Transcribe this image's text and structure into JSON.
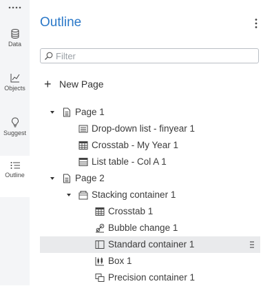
{
  "rail": {
    "items": [
      {
        "label": "Data",
        "icon": "database-icon"
      },
      {
        "label": "Objects",
        "icon": "line-chart-icon"
      },
      {
        "label": "Suggest",
        "icon": "lightbulb-icon"
      },
      {
        "label": "Outline",
        "icon": "outline-list-icon",
        "active": true
      }
    ]
  },
  "header": {
    "title": "Outline"
  },
  "search": {
    "placeholder": "Filter",
    "value": ""
  },
  "new_page_label": "New Page",
  "tree": {
    "page1": "Page 1",
    "dropdown": "Drop-down list - finyear 1",
    "crosstab_myyear": "Crosstab - My Year 1",
    "listtable": "List table - Col A 1",
    "page2": "Page 2",
    "stacking": "Stacking container 1",
    "crosstab1": "Crosstab 1",
    "bubble": "Bubble change 1",
    "standard": "Standard container 1",
    "box": "Box 1",
    "precision": "Precision container 1"
  },
  "colors": {
    "accent": "#2a78c8",
    "rail_bg": "#f4f5f7",
    "selected_bg": "#e9eaec"
  }
}
